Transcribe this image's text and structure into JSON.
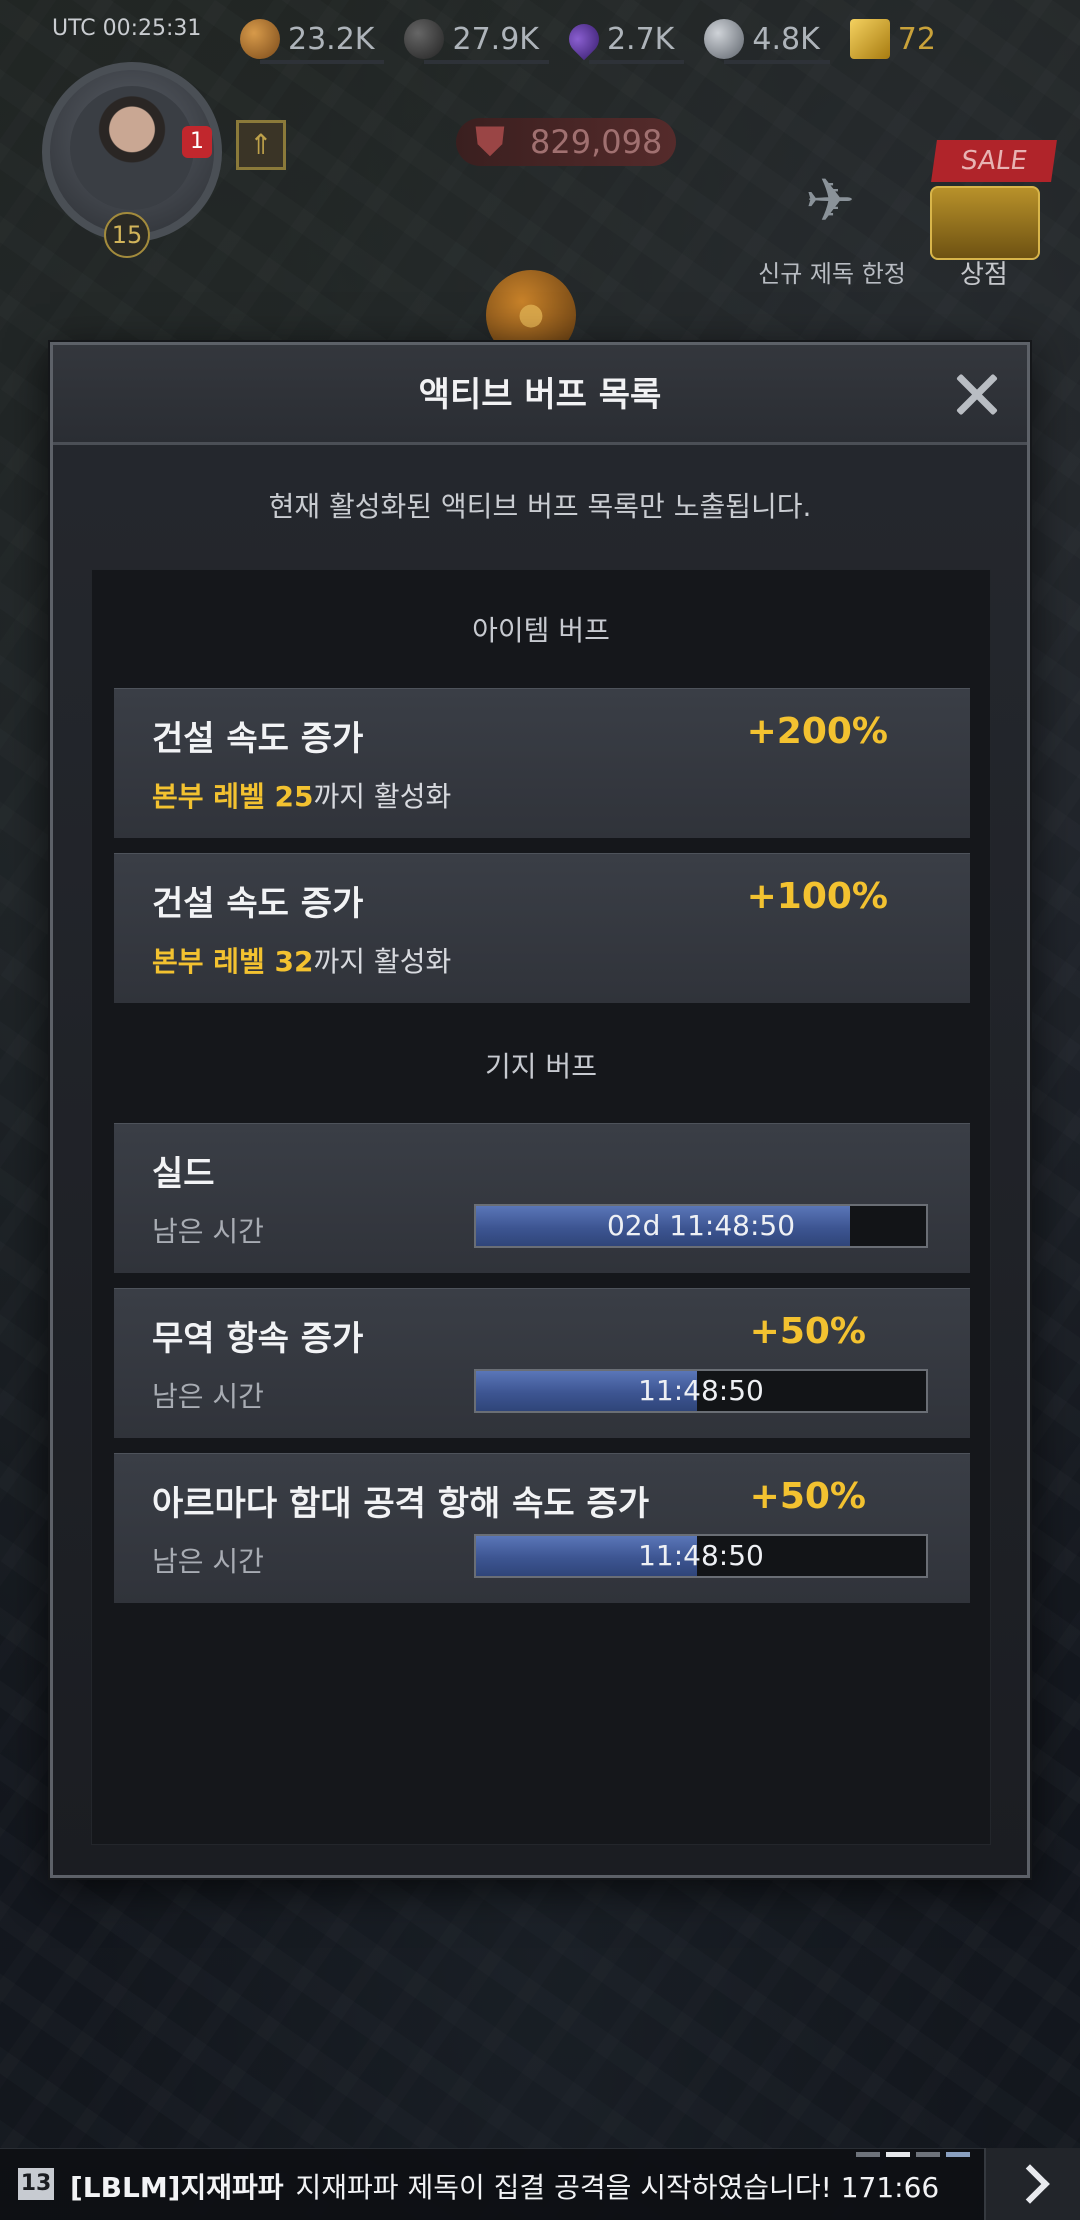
{
  "hud": {
    "utc_time": "UTC 00:25:31",
    "resources": [
      {
        "name": "food",
        "icon": "bread-icon",
        "value": "23.2K"
      },
      {
        "name": "oil",
        "icon": "oil-barrel-icon",
        "value": "27.9K"
      },
      {
        "name": "gas",
        "icon": "gas-drop-icon",
        "value": "2.7K"
      },
      {
        "name": "steel",
        "icon": "steel-ball-icon",
        "value": "4.8K"
      },
      {
        "name": "gold",
        "icon": "gold-bars-icon",
        "value": "72"
      }
    ],
    "notification_count": "1",
    "commander_level": "15",
    "power": "829,098",
    "sale_label": "SALE",
    "shop_label": "상점",
    "event_label": "신규 제독 한정",
    "event_sublabel": "!!",
    "event_count": "13"
  },
  "modal": {
    "title": "액티브 버프 목록",
    "subtitle": "현재 활성화된 액티브 버프 목록만 노출됩니다.",
    "sections": [
      {
        "header": "아이템 버프",
        "buffs": [
          {
            "name": "건설 속도 증가",
            "value": "+200%",
            "condition_highlight": "본부 레벨 25",
            "condition_rest": "까지 활성화"
          },
          {
            "name": "건설 속도 증가",
            "value": "+100%",
            "condition_highlight": "본부 레벨 32",
            "condition_rest": "까지 활성화"
          }
        ]
      },
      {
        "header": "기지 버프",
        "buffs": [
          {
            "name": "실드",
            "value": "",
            "remaining_label": "남은 시간",
            "timer": "02d 11:48:50",
            "progress": 0.83
          },
          {
            "name": "무역 항속 증가",
            "value": "+50%",
            "remaining_label": "남은 시간",
            "timer": "11:48:50",
            "progress": 0.49
          },
          {
            "name": "아르마다 함대 공격 항해 속도 증가",
            "value": "+50%",
            "remaining_label": "남은 시간",
            "timer": "11:48:50",
            "progress": 0.49
          }
        ]
      }
    ]
  },
  "chat": {
    "level": "13",
    "sender": "[LBLM]지재파파",
    "message": "지재파파 제독이 집결 공격을 시작하였습니다! 171:66"
  },
  "colors": {
    "accent_gold": "#f3c230",
    "timer_fill": "#3d5592",
    "sale_red": "#b0242a"
  }
}
